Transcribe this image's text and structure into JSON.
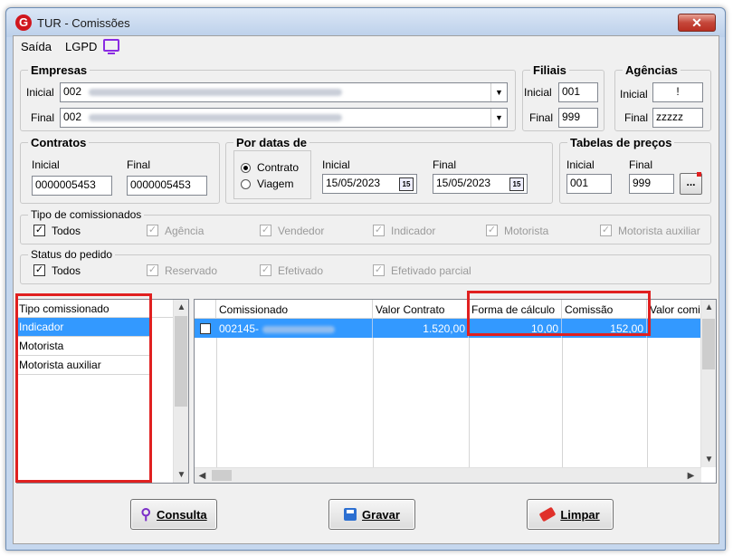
{
  "window": {
    "title": "TUR - Comissões",
    "close_label": "✕"
  },
  "menu": {
    "saida": "Saída",
    "lgpd": "LGPD"
  },
  "empresas": {
    "legend": "Empresas",
    "inicial_label": "Inicial",
    "inicial_value": "002",
    "final_label": "Final",
    "final_value": "002"
  },
  "filiais": {
    "legend": "Filiais",
    "inicial_label": "Inicial",
    "inicial_value": "001",
    "final_label": "Final",
    "final_value": "999"
  },
  "agencias": {
    "legend": "Agências",
    "inicial_label": "Inicial",
    "inicial_value": "!",
    "final_label": "Final",
    "final_value": "zzzzz"
  },
  "contratos": {
    "legend": "Contratos",
    "inicial_label": "Inicial",
    "inicial_value": "0000005453",
    "final_label": "Final",
    "final_value": "0000005453"
  },
  "por_datas": {
    "legend": "Por datas de",
    "radio_contrato": "Contrato",
    "radio_viagem": "Viagem",
    "inicial_label": "Inicial",
    "inicial_value": "15/05/2023",
    "final_label": "Final",
    "final_value": "15/05/2023",
    "cal_icon": "15"
  },
  "tabelas": {
    "legend": "Tabelas de preços",
    "inicial_label": "Inicial",
    "inicial_value": "001",
    "final_label": "Final",
    "final_value": "999",
    "browse_label": "..."
  },
  "tipo_comissionados": {
    "legend": "Tipo de comissionados",
    "options": [
      {
        "label": "Todos",
        "checked": true,
        "enabled": true
      },
      {
        "label": "Agência",
        "checked": true,
        "enabled": false
      },
      {
        "label": "Vendedor",
        "checked": true,
        "enabled": false
      },
      {
        "label": "Indicador",
        "checked": true,
        "enabled": false
      },
      {
        "label": "Motorista",
        "checked": true,
        "enabled": false
      },
      {
        "label": "Motorista auxiliar",
        "checked": true,
        "enabled": false
      }
    ]
  },
  "status_pedido": {
    "legend": "Status do pedido",
    "options": [
      {
        "label": "Todos",
        "checked": true,
        "enabled": true
      },
      {
        "label": "Reservado",
        "checked": true,
        "enabled": false
      },
      {
        "label": "Efetivado",
        "checked": true,
        "enabled": false
      },
      {
        "label": "Efetivado parcial",
        "checked": true,
        "enabled": false
      }
    ]
  },
  "tipo_list": {
    "header": "Tipo comissionado",
    "items": [
      "Indicador",
      "Motorista",
      "Motorista auxiliar"
    ],
    "selected_index": 0
  },
  "grid": {
    "columns": [
      "Comissionado",
      "Valor Contrato",
      "Forma de cálculo",
      "Comissão",
      "Valor comi"
    ],
    "rows": [
      {
        "comissionado": "002145-",
        "valor_contrato": "1.520,00",
        "forma_calculo": "10,00",
        "comissao": "152,00",
        "valor_comi": ""
      }
    ]
  },
  "buttons": {
    "consulta": "Consulta",
    "gravar": "Gravar",
    "limpar": "Limpar"
  },
  "colors": {
    "highlight": "#e02020",
    "selection": "#3399ff",
    "accent_purple": "#8a2be2"
  }
}
